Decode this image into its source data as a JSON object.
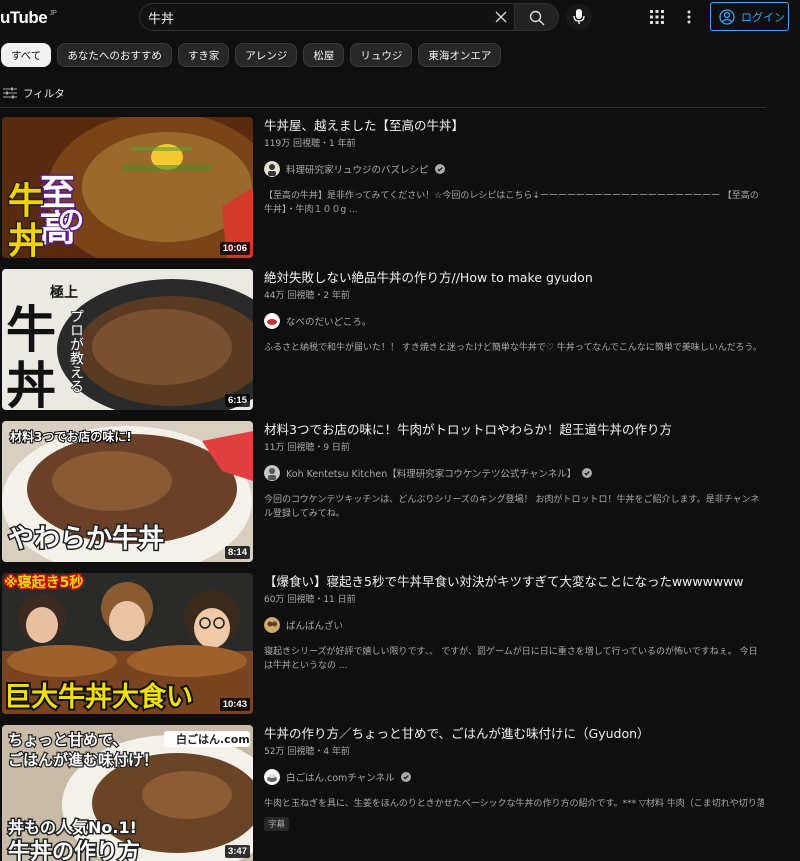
{
  "header": {
    "logo_text": "uTube",
    "logo_region": "JP",
    "search_value": "牛丼",
    "login_label": "ログイン"
  },
  "chips": [
    "すべて",
    "あなたへのおすすめ",
    "すき家",
    "アレンジ",
    "松屋",
    "リュウジ",
    "東海オンエア"
  ],
  "filter": {
    "label": "フィルタ"
  },
  "results": [
    {
      "title": "牛丼屋、越えました【至高の牛丼】",
      "meta": "119万 回視聴・1 年前",
      "channel": "料理研究家リュウジのバズレシピ",
      "verified": true,
      "desc": "【至高の牛丼】是非作ってみてください！☆今回のレシピはこちら↓ーーーーーーーーーーーーーーーーーーーー 【至高の牛丼】・牛肉１００g ...",
      "duration": "10:06",
      "thumb_text": [
        "至高",
        "の",
        "牛",
        "丼"
      ]
    },
    {
      "title": "絶対失敗しない絶品牛丼の作り方//How to make gyudon",
      "meta": "44万 回視聴・2 年前",
      "channel": "なべのだいどころ。",
      "verified": false,
      "desc": "ふるさと納税で和牛が届いた！！ すき焼きと迷ったけど簡単な牛丼で♡ 牛丼ってなんでこんなに簡単で美味しいんだろう。",
      "duration": "6:15",
      "thumb_text": [
        "極上",
        "牛",
        "丼",
        "プロが教える"
      ]
    },
    {
      "title": "材料3つでお店の味に！牛肉がトロットロやわらか！超王道牛丼の作り方",
      "meta": "11万 回視聴・9 日前",
      "channel": "Koh Kentetsu Kitchen【料理研究家コウケンテツ公式チャンネル】",
      "verified": true,
      "desc": "今回のコウケンテツキッチンは、どんぶりシリーズのキング登場！ お肉がトロットロ！牛丼をご紹介します。是非チャンネル登録してみてね。",
      "duration": "8:14",
      "thumb_text": [
        "材料3つでお店の味に!",
        "やわらか牛丼"
      ]
    },
    {
      "title": "【爆食い】寝起き5秒で牛丼早食い対決がキツすぎて大変なことになったwwwwwww",
      "meta": "60万 回視聴・11 日前",
      "channel": "ばんばんざい",
      "verified": false,
      "desc": "寝起きシリーズが好評で嬉しい限りです、、 ですが、罰ゲームが日に日に重さを増して行っているのが怖いですねぇ。 今日は牛丼というなの ...",
      "duration": "10:43",
      "thumb_text": [
        "※寝起き5秒",
        "巨大牛丼大食い"
      ]
    },
    {
      "title": "牛丼の作り方／ちょっと甘めで、ごはんが進む味付けに（Gyudon）",
      "meta": "52万 回視聴・4 年前",
      "channel": "白ごはん.comチャンネル",
      "verified": true,
      "desc": "牛肉と玉ねぎを具に、生姜をほんのりときかせたベーシックな牛丼の作り方の紹介です。*** ▽材料 牛肉（こま切れや切り落とし）...",
      "badge": "字幕",
      "duration": "3:47",
      "thumb_text": [
        "ちょっと甘めで、",
        "ごはんが進む味付け！",
        "白ごはん.com",
        "丼もの人気No.1!",
        "牛丼の作り方"
      ]
    }
  ]
}
